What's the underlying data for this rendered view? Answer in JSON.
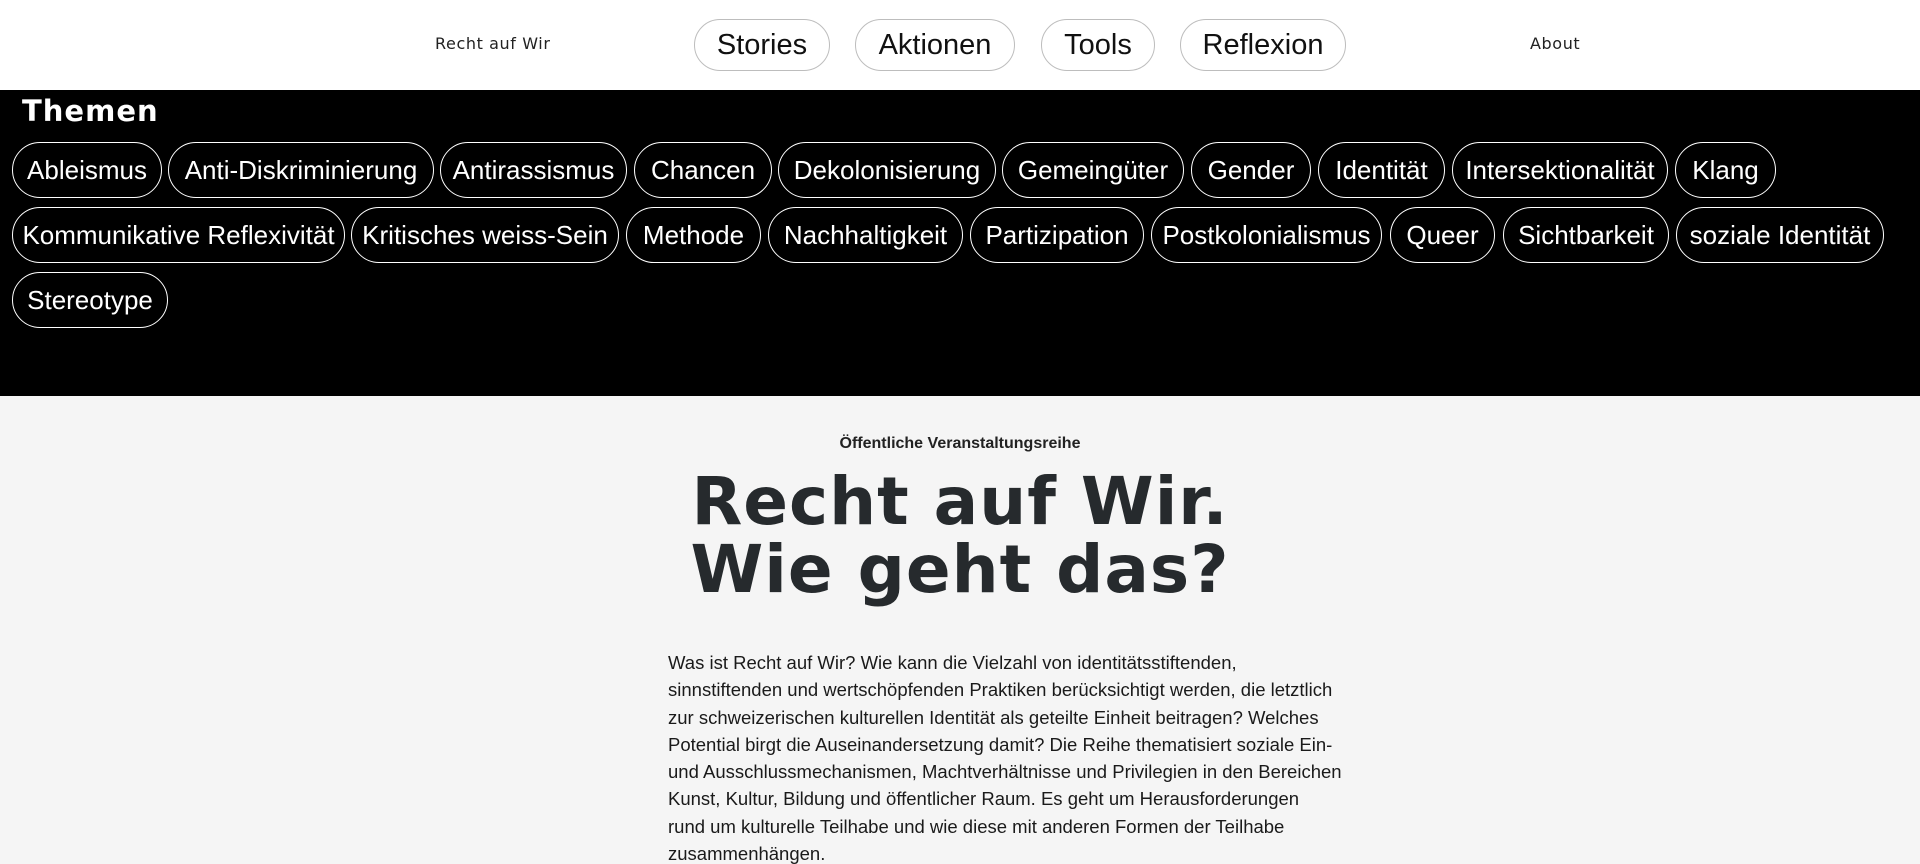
{
  "header": {
    "brand": "Recht auf Wir",
    "nav": [
      "Stories",
      "Aktionen",
      "Tools",
      "Reflexion"
    ],
    "about": "About"
  },
  "themes": {
    "title": "Themen",
    "tags": [
      "Ableismus",
      "Anti-Diskriminierung",
      "Antirassismus",
      "Chancen",
      "Dekolonisierung",
      "Gemeingüter",
      "Gender",
      "Identität",
      "Intersektionalität",
      "Klang",
      "Kommunikative Reflexivität",
      "Kritisches weiss-Sein",
      "Methode",
      "Nachhaltigkeit",
      "Partizipation",
      "Postkolonialismus",
      "Queer",
      "Sichtbarkeit",
      "soziale Identität",
      "Stereotype"
    ]
  },
  "intro": {
    "kicker": "Öffentliche Veranstaltungsreihe",
    "headline": [
      "Recht auf Wir.",
      "Wie geht das?"
    ],
    "lines": [
      "Was ist Recht auf Wir? Wie kann die Vielzahl von identitätsstiftenden,",
      "sinnstiftenden und wertschöpfenden Praktiken berücksichtigt werden, die letztlich",
      "zur schweizerischen kulturellen Identität als geteilte Einheit beitragen? Welches",
      "Potential birgt die Auseinandersetzung damit? Die Reihe thematisiert soziale Ein-",
      "und Ausschlussmechanismen, Machtverhältnisse und Privilegien in den Bereichen",
      "Kunst, Kultur, Bildung und öffentlicher Raum. Es geht um Herausforderungen",
      "rund um kulturelle Teilhabe und wie diese mit anderen Formen der Teilhabe",
      "zusammenhängen."
    ]
  },
  "colors": {
    "header_bg": "#ffffff",
    "themes_bg": "#000000",
    "page_bg": "#f5f5f5",
    "headline": "#262a2d"
  }
}
